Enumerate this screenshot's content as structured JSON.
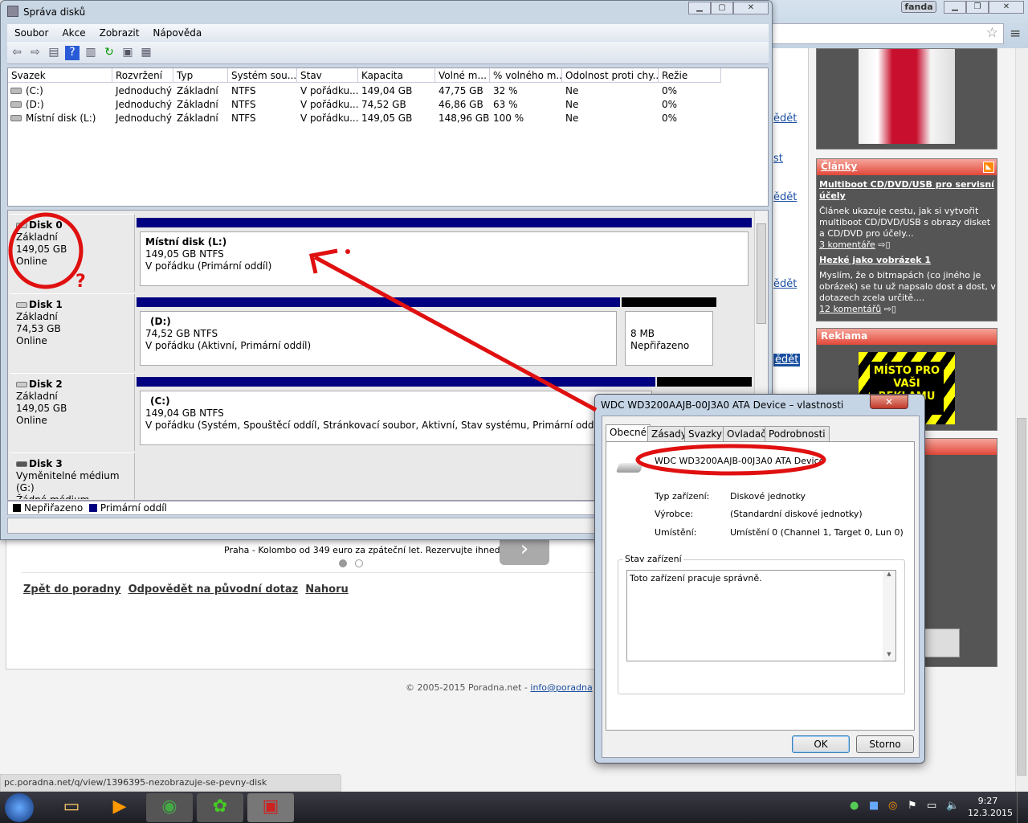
{
  "browser": {
    "user": "fanda",
    "status_url": "pc.poradna.net/q/view/1396395-nezobrazuje-se-pevny-disk",
    "partial_links": [
      "ědět",
      "st",
      "ědět",
      "ědět",
      "ědět"
    ],
    "ad_text": "Praha - Kolombo od 349 euro za zpáteční let. Rezervujte ihned.",
    "nav_links": [
      "Zpět do poradny",
      "Odpovědět na původní dotaz",
      "Nahoru"
    ],
    "footer_text": "© 2005-2015 Poradna.net - ",
    "footer_link": "info@poradna",
    "sidebar": {
      "articles_title": "Články",
      "articles": [
        {
          "title": "Multiboot CD/DVD/USB pro servisní účely",
          "text": "Článek ukazuje cestu, jak si vytvořit multiboot CD/DVD/USB s obrazy disket a CD/DVD pro účely...",
          "comments": "3 komentáře"
        },
        {
          "title": "Hezké jako vobrázek 1",
          "text": "Myslím, že o bitmapách (co jiného je obrázek) se tu už napsalo dost a dost, v dotazech zcela určitě....",
          "comments": "12 komentářů"
        }
      ],
      "ad_title": "Reklama",
      "ad_banner": "MÍSTO PRO VAŠI REKLAMU"
    }
  },
  "diskmgmt": {
    "title": "Správa disků",
    "menu": [
      "Soubor",
      "Akce",
      "Zobrazit",
      "Nápověda"
    ],
    "columns": [
      "Svazek",
      "Rozvržení",
      "Typ",
      "Systém sou...",
      "Stav",
      "Kapacita",
      "Volné m...",
      "% volného m...",
      "Odolnost proti chy...",
      "Režie"
    ],
    "volumes": [
      [
        "(C:)",
        "Jednoduchý",
        "Základní",
        "NTFS",
        "V pořádku...",
        "149,04 GB",
        "47,75 GB",
        "32 %",
        "Ne",
        "0%"
      ],
      [
        "(D:)",
        "Jednoduchý",
        "Základní",
        "NTFS",
        "V pořádku...",
        "74,52 GB",
        "46,86 GB",
        "63 %",
        "Ne",
        "0%"
      ],
      [
        "Místní disk (L:)",
        "Jednoduchý",
        "Základní",
        "NTFS",
        "V pořádku...",
        "149,05 GB",
        "148,96 GB",
        "100 %",
        "Ne",
        "0%"
      ]
    ],
    "disks": [
      {
        "name": "Disk 0",
        "type": "Základní",
        "size": "149,05 GB",
        "state": "Online",
        "partitions": [
          {
            "label": "Místní disk  (L:)",
            "size": "149,05 GB NTFS",
            "status": "V pořádku (Primární oddíl)"
          }
        ]
      },
      {
        "name": "Disk 1",
        "type": "Základní",
        "size": "74,53 GB",
        "state": "Online",
        "partitions": [
          {
            "label": "(D:)",
            "size": "74,52 GB NTFS",
            "status": "V pořádku (Aktivní, Primární oddíl)"
          },
          {
            "label": "",
            "size": "8 MB",
            "status": "Nepřiřazeno"
          }
        ]
      },
      {
        "name": "Disk 2",
        "type": "Základní",
        "size": "149,05 GB",
        "state": "Online",
        "partitions": [
          {
            "label": "(C:)",
            "size": "149,04 GB NTFS",
            "status": "V pořádku (Systém, Spouštěcí oddíl, Stránkovací soubor, Aktivní, Stav systému, Primární oddíl)"
          }
        ]
      },
      {
        "name": "Disk 3",
        "type": "Vyměnitelné médium (G:)",
        "size": "",
        "state": "Žádné médium",
        "partitions": []
      }
    ],
    "legend": [
      "Nepřiřazeno",
      "Primární oddíl"
    ],
    "colors": {
      "primary": "#000080",
      "unallocated": "#000000"
    }
  },
  "dialog": {
    "title": "WDC WD3200AAJB-00J3A0 ATA Device – vlastnosti",
    "tabs": [
      "Obecné",
      "Zásady",
      "Svazky",
      "Ovladač",
      "Podrobnosti"
    ],
    "device_name": "WDC WD3200AAJB-00J3A0 ATA Device",
    "props": [
      [
        "Typ zařízení:",
        "Diskové jednotky"
      ],
      [
        "Výrobce:",
        "(Standardní diskové jednotky)"
      ],
      [
        "Umístění:",
        "Umístění 0 (Channel 1, Target 0, Lun 0)"
      ]
    ],
    "status_group": "Stav zařízení",
    "status_text": "Toto zařízení pracuje správně.",
    "ok": "OK",
    "cancel": "Storno"
  },
  "annotations": {
    "question_mark": "?",
    "color": "#e01010"
  },
  "taskbar": {
    "time": "9:27",
    "date": "12.3.2015"
  }
}
